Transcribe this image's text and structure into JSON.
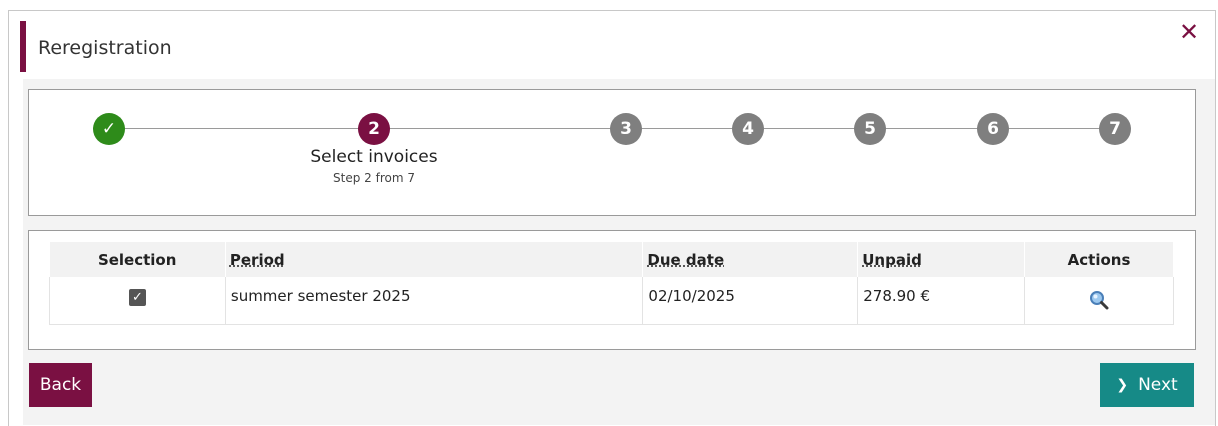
{
  "dialog": {
    "title": "Reregistration",
    "close_glyph": "✕",
    "accent_color": "#7a1042"
  },
  "stepper": {
    "current_step": 2,
    "total_steps": 7,
    "steps": [
      {
        "label": "✓",
        "status": "done"
      },
      {
        "label": "2",
        "status": "active",
        "title": "Select invoices",
        "subtitle": "Step 2 from 7"
      },
      {
        "label": "3",
        "status": "pending"
      },
      {
        "label": "4",
        "status": "pending"
      },
      {
        "label": "5",
        "status": "pending"
      },
      {
        "label": "6",
        "status": "pending"
      },
      {
        "label": "7",
        "status": "pending"
      }
    ]
  },
  "table": {
    "headers": {
      "selection": "Selection",
      "period": "Period",
      "due_date": "Due date",
      "unpaid": "Unpaid",
      "actions": "Actions"
    },
    "rows": [
      {
        "selected": true,
        "checkbox_glyph": "✓",
        "period": "summer semester 2025",
        "due_date": "02/10/2025",
        "unpaid": "278.90 €",
        "action_icon": "magnifier-icon"
      }
    ]
  },
  "footer": {
    "back_label": "Back",
    "next_label": "Next",
    "next_icon": "chevron-right-icon",
    "back_color": "#7a1042",
    "next_color": "#168a87"
  }
}
